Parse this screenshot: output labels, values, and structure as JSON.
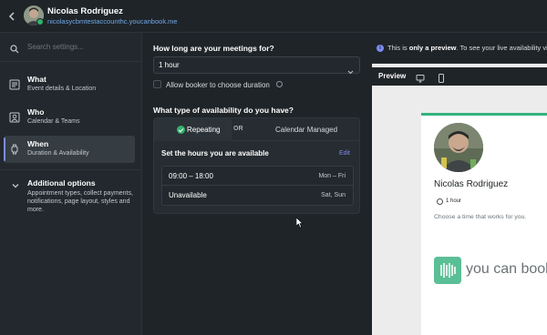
{
  "header": {
    "back_icon": "chevron-left-icon",
    "user_name": "Nicolas Rodriguez",
    "user_url": "nicolasycbmtestaccounthc.youcanbook.me",
    "status_color": "#31b36b"
  },
  "sidebar": {
    "search_placeholder": "Search settings...",
    "items": [
      {
        "title": "What",
        "subtitle": "Event details & Location",
        "icon": "document-icon"
      },
      {
        "title": "Who",
        "subtitle": "Calendar & Teams",
        "icon": "user-card-icon"
      },
      {
        "title": "When",
        "subtitle": "Duration & Availability",
        "icon": "watch-icon",
        "active": true
      }
    ],
    "additional": {
      "title": "Additional options",
      "description": "Appointment types, collect payments, notifications, page layout, styles and more.",
      "icon": "chevron-down-icon"
    }
  },
  "main": {
    "duration_question": "How long are your meetings for?",
    "duration_value": "1 hour",
    "allow_label": "Allow booker to choose duration",
    "availability_question": "What type of availability do you have?",
    "segment": {
      "repeating": "Repeating",
      "or": "OR",
      "calendar_managed": "Calendar Managed"
    },
    "hours_title": "Set the hours you are available",
    "edit_label": "Edit",
    "rows": [
      {
        "left": "09:00 – 18:00",
        "right": "Mon – Fri"
      },
      {
        "left": "Unavailable",
        "right": "Sat, Sun"
      }
    ]
  },
  "preview": {
    "notice_prefix": "This is ",
    "notice_bold": "only a preview",
    "notice_suffix": ". To see your live availability visit",
    "label": "Preview",
    "booking_page": {
      "name": "Nicolas Rodriguez",
      "duration": "1 hour",
      "hint": "Choose a time that works for you.",
      "logo_text": "you can book"
    },
    "accent_color": "#35b37e"
  },
  "colors": {
    "accent": "#7f8bf0",
    "background": "#1f2428",
    "success": "#31b36b"
  }
}
